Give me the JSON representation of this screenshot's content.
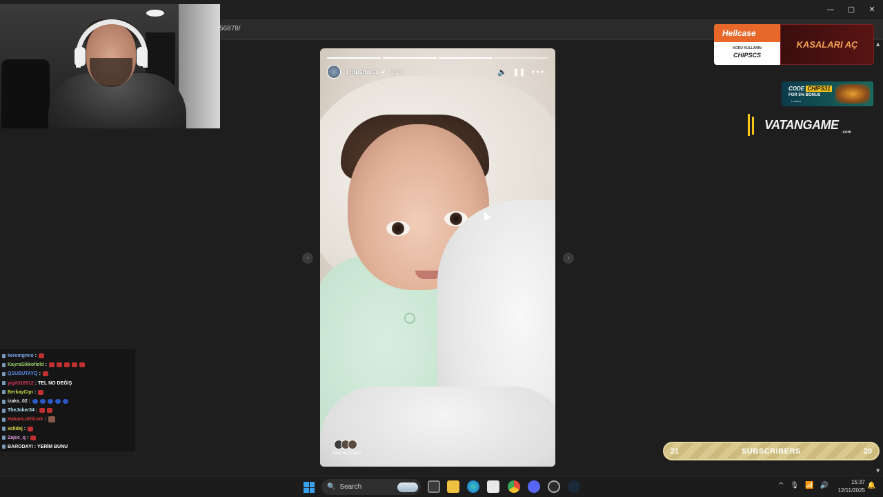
{
  "browser": {
    "url": "56878/",
    "window_controls": {
      "minimize": "—",
      "maximize": "▢",
      "close": "✕"
    }
  },
  "story": {
    "username": "chipsmusti",
    "verified_icon": "verified-check-icon",
    "time_ago": "17 h",
    "progress_segments": 4,
    "progress_completed": 3,
    "controls": {
      "mute": "🔈",
      "pause": "❚❚",
      "more": "•••"
    },
    "seen_by": "Seen by 22,642",
    "prev_arrow": "‹",
    "next_arrow": "›"
  },
  "overlays": {
    "hellcase": {
      "logo": "Hellcase",
      "code_label": "KODU KULLANIN",
      "code": "CHIPSCS",
      "cta": "KASALARI AÇ"
    },
    "chips_banner": {
      "code_prefix": "CODE",
      "code": "CHIPS31",
      "bonus": "FOR 5% BONUS",
      "brand": "Lootbox"
    },
    "vatangame": {
      "name": "VATANGAME",
      "tld": ".com"
    },
    "subscribers": {
      "left": "21",
      "label": "SUBSCRIBERS",
      "right": "20"
    }
  },
  "chat": [
    {
      "user": "keremgnno",
      "color": "#7aa8e8",
      "msg": ":",
      "emotes": [
        "red"
      ]
    },
    {
      "user": "KayraSikkofield",
      "color": "#9ad26a",
      "msg": ":",
      "emotes": [
        "red",
        "red",
        "red",
        "red",
        "red"
      ]
    },
    {
      "user": "QSUBUTAYQ",
      "color": "#5a8ae8",
      "msg": ":",
      "emotes": [
        "red"
      ]
    },
    {
      "user": "yigit316912",
      "color": "#d83a5a",
      "msg": ": TEL NO DEĞİŞ",
      "emotes": []
    },
    {
      "user": "BerkayCqn",
      "color": "#c8d84a",
      "msg": ":",
      "emotes": [
        "red"
      ]
    },
    {
      "user": "izaks_02",
      "color": "#e8e8e8",
      "msg": ":",
      "emotes": [
        "blue",
        "blue",
        "blue",
        "blue",
        "blue"
      ]
    },
    {
      "user": "TheJoker34",
      "color": "#b8e8f8",
      "msg": ":",
      "emotes": [
        "red",
        "red"
      ]
    },
    {
      "user": "HakanLothbrok",
      "color": "#d83a3a",
      "msg": ":",
      "emotes": [
        "img"
      ]
    },
    {
      "user": "xclidej",
      "color": "#e8e04a",
      "msg": ":",
      "emotes": [
        "red"
      ]
    },
    {
      "user": "Zajcc_q",
      "color": "#e8a0e8",
      "msg": ":",
      "emotes": [
        "red"
      ]
    },
    {
      "user": "BARODAYI",
      "color": "#f0f0f0",
      "msg": ": YERİM BUNU",
      "emotes": []
    }
  ],
  "taskbar": {
    "search_placeholder": "Search",
    "search_icon": "🔍",
    "clock_time": "15:37",
    "clock_date": "12/11/2025",
    "tray": {
      "chevron": "^",
      "mic": "🎙",
      "wifi": "📶",
      "volume": "🔊"
    },
    "notification_icon": "🔔",
    "pinned_apps": [
      "task-view",
      "file-explorer",
      "edge",
      "store",
      "chrome",
      "discord",
      "app-icon",
      "steam"
    ]
  },
  "colors": {
    "hellcase_orange": "#e8682a",
    "accent_blue": "#3aa0f0",
    "subs_gold": "#cdbb7e"
  }
}
